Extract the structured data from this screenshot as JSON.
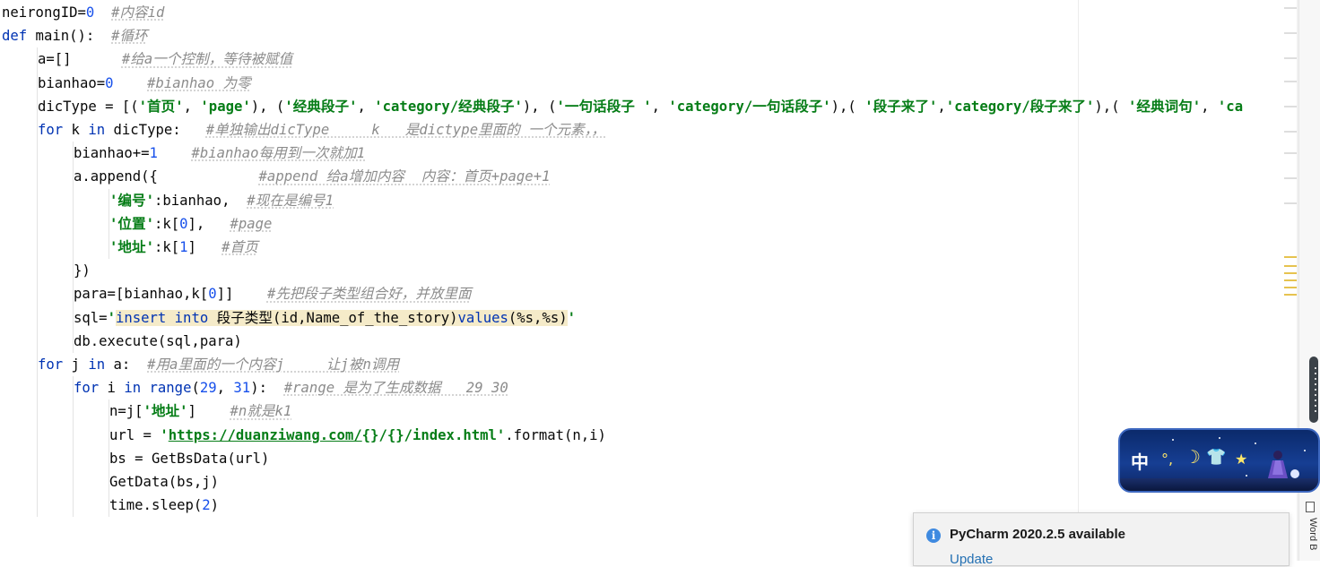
{
  "code_lines": [
    {
      "indent": 0,
      "tokens": [
        {
          "t": "neirongID=",
          "c": "plain"
        },
        {
          "t": "0",
          "c": "num"
        },
        {
          "t": "  ",
          "c": "plain"
        },
        {
          "t": "#内容id",
          "c": "cmt"
        }
      ]
    },
    {
      "indent": 0,
      "tokens": [
        {
          "t": "def",
          "c": "kw"
        },
        {
          "t": " main():  ",
          "c": "plain"
        },
        {
          "t": "#循环",
          "c": "cmt"
        }
      ]
    },
    {
      "indent": 1,
      "tokens": [
        {
          "t": "a=[]      ",
          "c": "plain"
        },
        {
          "t": "#给a一个控制，等待被赋值",
          "c": "cmt"
        }
      ]
    },
    {
      "indent": 1,
      "tokens": [
        {
          "t": "bianhao=",
          "c": "plain"
        },
        {
          "t": "0",
          "c": "num"
        },
        {
          "t": "    ",
          "c": "plain"
        },
        {
          "t": "#bianhao 为零",
          "c": "cmt"
        }
      ]
    },
    {
      "indent": 1,
      "tokens": [
        {
          "t": "dicType = [(",
          "c": "plain"
        },
        {
          "t": "'首页'",
          "c": "str"
        },
        {
          "t": ", ",
          "c": "plain"
        },
        {
          "t": "'page'",
          "c": "str"
        },
        {
          "t": "), (",
          "c": "plain"
        },
        {
          "t": "'经典段子'",
          "c": "str"
        },
        {
          "t": ", ",
          "c": "plain"
        },
        {
          "t": "'category/经典段子'",
          "c": "str"
        },
        {
          "t": "), (",
          "c": "plain"
        },
        {
          "t": "'一句话段子 '",
          "c": "str"
        },
        {
          "t": ", ",
          "c": "plain"
        },
        {
          "t": "'category/一句话段子'",
          "c": "str"
        },
        {
          "t": "),( ",
          "c": "plain"
        },
        {
          "t": "'段子来了'",
          "c": "str"
        },
        {
          "t": ",",
          "c": "plain"
        },
        {
          "t": "'category/段子来了'",
          "c": "str"
        },
        {
          "t": "),( ",
          "c": "plain"
        },
        {
          "t": "'经典词句'",
          "c": "str"
        },
        {
          "t": ", ",
          "c": "plain"
        },
        {
          "t": "'ca",
          "c": "str"
        }
      ]
    },
    {
      "indent": 1,
      "tokens": [
        {
          "t": "for",
          "c": "kw"
        },
        {
          "t": " k ",
          "c": "plain"
        },
        {
          "t": "in",
          "c": "kw"
        },
        {
          "t": " dicType:   ",
          "c": "plain"
        },
        {
          "t": "#单独输出dicType     k   是dictype里面的 一个元素，，",
          "c": "cmt"
        }
      ]
    },
    {
      "indent": 2,
      "tokens": [
        {
          "t": "bianhao+=",
          "c": "plain"
        },
        {
          "t": "1",
          "c": "num"
        },
        {
          "t": "    ",
          "c": "plain"
        },
        {
          "t": "#bianhao每用到一次就加1",
          "c": "cmt"
        }
      ]
    },
    {
      "indent": 2,
      "tokens": [
        {
          "t": "a.append({            ",
          "c": "plain"
        },
        {
          "t": "#append 给a增加内容  内容：首页+page+1",
          "c": "cmt"
        }
      ]
    },
    {
      "indent": 3,
      "tokens": [
        {
          "t": "'编号'",
          "c": "str"
        },
        {
          "t": ":bianhao,  ",
          "c": "plain"
        },
        {
          "t": "#现在是编号1",
          "c": "cmt"
        }
      ]
    },
    {
      "indent": 3,
      "tokens": [
        {
          "t": "'位置'",
          "c": "str"
        },
        {
          "t": ":k[",
          "c": "plain"
        },
        {
          "t": "0",
          "c": "num"
        },
        {
          "t": "],   ",
          "c": "plain"
        },
        {
          "t": "#page",
          "c": "cmt"
        }
      ]
    },
    {
      "indent": 3,
      "tokens": [
        {
          "t": "'地址'",
          "c": "str"
        },
        {
          "t": ":k[",
          "c": "plain"
        },
        {
          "t": "1",
          "c": "num"
        },
        {
          "t": "]   ",
          "c": "plain"
        },
        {
          "t": "#首页",
          "c": "cmt"
        }
      ]
    },
    {
      "indent": 2,
      "tokens": [
        {
          "t": "})",
          "c": "plain"
        }
      ]
    },
    {
      "indent": 2,
      "tokens": [
        {
          "t": "para=[bianhao,k[",
          "c": "plain"
        },
        {
          "t": "0",
          "c": "num"
        },
        {
          "t": "]]    ",
          "c": "plain"
        },
        {
          "t": "#先把段子类型组合好，并放里面",
          "c": "cmt"
        }
      ]
    },
    {
      "indent": 2,
      "tokens": [
        {
          "t": "sql=",
          "c": "plain"
        },
        {
          "t": "'",
          "c": "str"
        },
        {
          "t": "insert into",
          "c": "sqlkw_hl"
        },
        {
          "t": " 段子类型(id,Name_of_the_story)",
          "c": "sql_hl"
        },
        {
          "t": "values",
          "c": "sqlkw_hl"
        },
        {
          "t": "(%s,%s)",
          "c": "sql_hl"
        },
        {
          "t": "'",
          "c": "str"
        }
      ]
    },
    {
      "indent": 2,
      "tokens": [
        {
          "t": "db.execute(sql,para)",
          "c": "plain"
        }
      ]
    },
    {
      "indent": 1,
      "tokens": [
        {
          "t": "for",
          "c": "kw"
        },
        {
          "t": " j ",
          "c": "plain"
        },
        {
          "t": "in",
          "c": "kw"
        },
        {
          "t": " a:  ",
          "c": "plain"
        },
        {
          "t": "#用a里面的一个内容j     让j被n调用",
          "c": "cmt"
        }
      ]
    },
    {
      "indent": 2,
      "tokens": [
        {
          "t": "for",
          "c": "kw"
        },
        {
          "t": " i ",
          "c": "plain"
        },
        {
          "t": "in",
          "c": "kw"
        },
        {
          "t": " ",
          "c": "plain"
        },
        {
          "t": "range",
          "c": "kw"
        },
        {
          "t": "(",
          "c": "plain"
        },
        {
          "t": "29",
          "c": "num"
        },
        {
          "t": ", ",
          "c": "plain"
        },
        {
          "t": "31",
          "c": "num"
        },
        {
          "t": "):  ",
          "c": "plain"
        },
        {
          "t": "#range 是为了生成数据   29 30",
          "c": "cmt"
        }
      ]
    },
    {
      "indent": 3,
      "tokens": [
        {
          "t": "n=j[",
          "c": "plain"
        },
        {
          "t": "'地址'",
          "c": "str"
        },
        {
          "t": "]    ",
          "c": "plain"
        },
        {
          "t": "#n就是k1",
          "c": "cmt"
        }
      ]
    },
    {
      "indent": 3,
      "tokens": [
        {
          "t": "url = ",
          "c": "plain"
        },
        {
          "t": "'",
          "c": "str"
        },
        {
          "t": "https://duanziwang.com/",
          "c": "link"
        },
        {
          "t": "{}/{}/index.html",
          "c": "str"
        },
        {
          "t": "'",
          "c": "str"
        },
        {
          "t": ".format(n,i)",
          "c": "plain"
        }
      ]
    },
    {
      "indent": 3,
      "tokens": [
        {
          "t": "bs = GetBsData(url)",
          "c": "plain"
        }
      ]
    },
    {
      "indent": 3,
      "tokens": [
        {
          "t": "GetData(bs,j)",
          "c": "plain"
        }
      ]
    },
    {
      "indent": 3,
      "tokens": [
        {
          "t": "time.sleep(",
          "c": "plain"
        },
        {
          "t": "2",
          "c": "num"
        },
        {
          "t": ")",
          "c": "plain"
        }
      ]
    }
  ],
  "notification": {
    "title": "PyCharm 2020.2.5 available",
    "link": "Update",
    "icon": "info-icon"
  },
  "ime": {
    "mode_label": "中",
    "punct_icon": "°,",
    "moon_icon": "☽",
    "skin_icon": "👕",
    "star_icon": "★"
  },
  "gutter": {
    "word_label": "Word B"
  },
  "colors": {
    "keyword": "#0033b3",
    "number": "#1750eb",
    "string": "#067d17",
    "comment": "#8c8c8c",
    "sql_highlight": "#f5ebc9",
    "notification_link": "#2470b3",
    "info_icon": "#3f8ae0"
  }
}
